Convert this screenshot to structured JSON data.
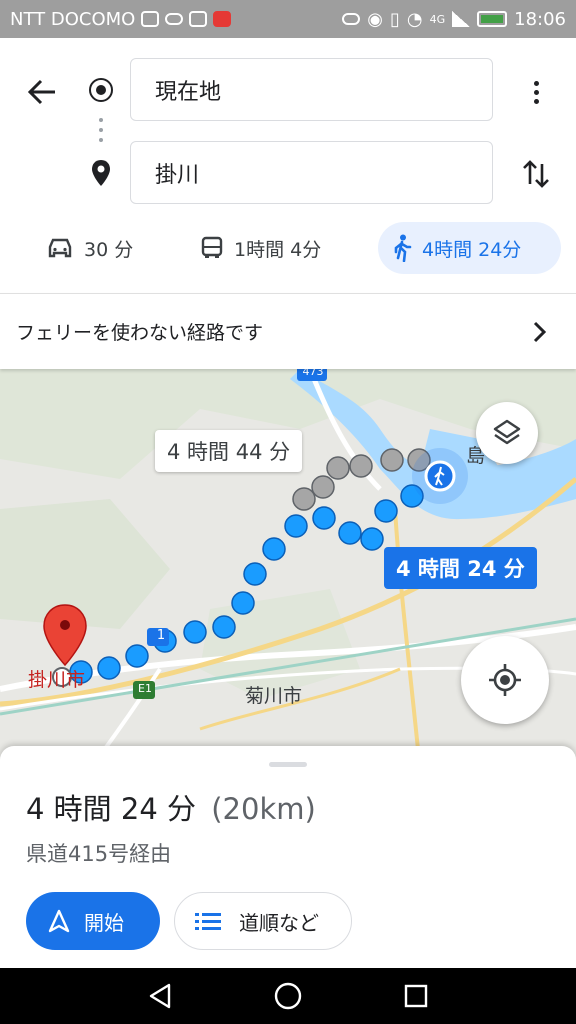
{
  "status_bar": {
    "carrier": "NTT DOCOMO",
    "network": "4G",
    "time": "18:06",
    "battery_color": "#43a047"
  },
  "search": {
    "origin_value": "現在地",
    "destination_value": "掛川"
  },
  "modes": [
    {
      "icon": "car-icon",
      "label": "30 分"
    },
    {
      "icon": "bus-icon",
      "label": "1時間 4分"
    },
    {
      "icon": "walk-icon",
      "label": "4時間 24分",
      "selected": true
    }
  ],
  "notice": {
    "text": "フェリーを使わない経路です"
  },
  "map": {
    "alt_route_time": "4 時間 44 分",
    "main_route_time": "4 時間 24 分",
    "place_kakegawa": "掛川市",
    "place_kikugawa": "菊川市",
    "place_shimada": "島",
    "road_1": "1",
    "road_e1": "E1",
    "road_473": "473",
    "route_color": "#1a9cff",
    "alt_route_color": "#a6a6a6",
    "water_color": "#aadaff"
  },
  "sheet": {
    "duration": "4 時間 24 分",
    "distance": "(20km)",
    "via": "県道415号経由",
    "start_label": "開始",
    "steps_label": "道順など"
  },
  "accent": "#1a73e8"
}
